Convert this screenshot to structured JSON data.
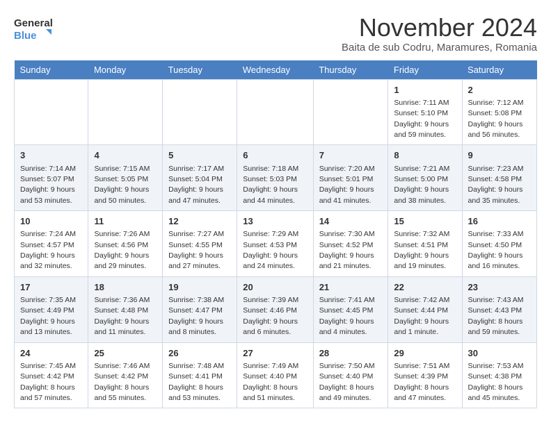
{
  "logo": {
    "line1": "General",
    "line2": "Blue"
  },
  "title": "November 2024",
  "subtitle": "Baita de sub Codru, Maramures, Romania",
  "weekdays": [
    "Sunday",
    "Monday",
    "Tuesday",
    "Wednesday",
    "Thursday",
    "Friday",
    "Saturday"
  ],
  "weeks": [
    [
      {
        "day": "",
        "info": ""
      },
      {
        "day": "",
        "info": ""
      },
      {
        "day": "",
        "info": ""
      },
      {
        "day": "",
        "info": ""
      },
      {
        "day": "",
        "info": ""
      },
      {
        "day": "1",
        "info": "Sunrise: 7:11 AM\nSunset: 5:10 PM\nDaylight: 9 hours and 59 minutes."
      },
      {
        "day": "2",
        "info": "Sunrise: 7:12 AM\nSunset: 5:08 PM\nDaylight: 9 hours and 56 minutes."
      }
    ],
    [
      {
        "day": "3",
        "info": "Sunrise: 7:14 AM\nSunset: 5:07 PM\nDaylight: 9 hours and 53 minutes."
      },
      {
        "day": "4",
        "info": "Sunrise: 7:15 AM\nSunset: 5:05 PM\nDaylight: 9 hours and 50 minutes."
      },
      {
        "day": "5",
        "info": "Sunrise: 7:17 AM\nSunset: 5:04 PM\nDaylight: 9 hours and 47 minutes."
      },
      {
        "day": "6",
        "info": "Sunrise: 7:18 AM\nSunset: 5:03 PM\nDaylight: 9 hours and 44 minutes."
      },
      {
        "day": "7",
        "info": "Sunrise: 7:20 AM\nSunset: 5:01 PM\nDaylight: 9 hours and 41 minutes."
      },
      {
        "day": "8",
        "info": "Sunrise: 7:21 AM\nSunset: 5:00 PM\nDaylight: 9 hours and 38 minutes."
      },
      {
        "day": "9",
        "info": "Sunrise: 7:23 AM\nSunset: 4:58 PM\nDaylight: 9 hours and 35 minutes."
      }
    ],
    [
      {
        "day": "10",
        "info": "Sunrise: 7:24 AM\nSunset: 4:57 PM\nDaylight: 9 hours and 32 minutes."
      },
      {
        "day": "11",
        "info": "Sunrise: 7:26 AM\nSunset: 4:56 PM\nDaylight: 9 hours and 29 minutes."
      },
      {
        "day": "12",
        "info": "Sunrise: 7:27 AM\nSunset: 4:55 PM\nDaylight: 9 hours and 27 minutes."
      },
      {
        "day": "13",
        "info": "Sunrise: 7:29 AM\nSunset: 4:53 PM\nDaylight: 9 hours and 24 minutes."
      },
      {
        "day": "14",
        "info": "Sunrise: 7:30 AM\nSunset: 4:52 PM\nDaylight: 9 hours and 21 minutes."
      },
      {
        "day": "15",
        "info": "Sunrise: 7:32 AM\nSunset: 4:51 PM\nDaylight: 9 hours and 19 minutes."
      },
      {
        "day": "16",
        "info": "Sunrise: 7:33 AM\nSunset: 4:50 PM\nDaylight: 9 hours and 16 minutes."
      }
    ],
    [
      {
        "day": "17",
        "info": "Sunrise: 7:35 AM\nSunset: 4:49 PM\nDaylight: 9 hours and 13 minutes."
      },
      {
        "day": "18",
        "info": "Sunrise: 7:36 AM\nSunset: 4:48 PM\nDaylight: 9 hours and 11 minutes."
      },
      {
        "day": "19",
        "info": "Sunrise: 7:38 AM\nSunset: 4:47 PM\nDaylight: 9 hours and 8 minutes."
      },
      {
        "day": "20",
        "info": "Sunrise: 7:39 AM\nSunset: 4:46 PM\nDaylight: 9 hours and 6 minutes."
      },
      {
        "day": "21",
        "info": "Sunrise: 7:41 AM\nSunset: 4:45 PM\nDaylight: 9 hours and 4 minutes."
      },
      {
        "day": "22",
        "info": "Sunrise: 7:42 AM\nSunset: 4:44 PM\nDaylight: 9 hours and 1 minute."
      },
      {
        "day": "23",
        "info": "Sunrise: 7:43 AM\nSunset: 4:43 PM\nDaylight: 8 hours and 59 minutes."
      }
    ],
    [
      {
        "day": "24",
        "info": "Sunrise: 7:45 AM\nSunset: 4:42 PM\nDaylight: 8 hours and 57 minutes."
      },
      {
        "day": "25",
        "info": "Sunrise: 7:46 AM\nSunset: 4:42 PM\nDaylight: 8 hours and 55 minutes."
      },
      {
        "day": "26",
        "info": "Sunrise: 7:48 AM\nSunset: 4:41 PM\nDaylight: 8 hours and 53 minutes."
      },
      {
        "day": "27",
        "info": "Sunrise: 7:49 AM\nSunset: 4:40 PM\nDaylight: 8 hours and 51 minutes."
      },
      {
        "day": "28",
        "info": "Sunrise: 7:50 AM\nSunset: 4:40 PM\nDaylight: 8 hours and 49 minutes."
      },
      {
        "day": "29",
        "info": "Sunrise: 7:51 AM\nSunset: 4:39 PM\nDaylight: 8 hours and 47 minutes."
      },
      {
        "day": "30",
        "info": "Sunrise: 7:53 AM\nSunset: 4:38 PM\nDaylight: 8 hours and 45 minutes."
      }
    ]
  ]
}
